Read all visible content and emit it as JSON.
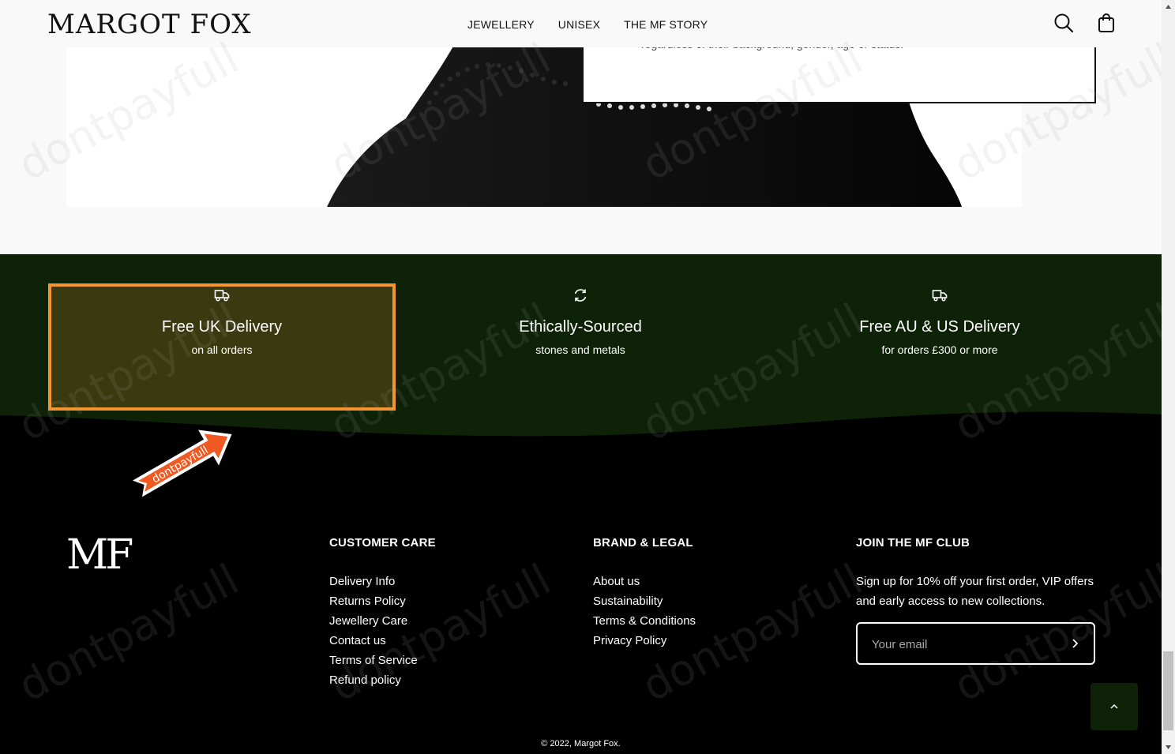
{
  "header": {
    "logo": "MARGOT FOX",
    "nav": [
      "JEWELLERY",
      "UNISEX",
      "THE MF STORY"
    ],
    "search_icon": "search-icon",
    "cart_icon": "shopping-bag-icon"
  },
  "story": {
    "text": "regardless of their background, gender, age or status."
  },
  "usps": [
    {
      "icon": "delivery-truck-icon",
      "title": "Free UK Delivery",
      "subtitle": "on all orders"
    },
    {
      "icon": "refresh-icon",
      "title": "Ethically-Sourced",
      "subtitle": "stones and metals"
    },
    {
      "icon": "delivery-truck-icon",
      "title": "Free AU & US Delivery",
      "subtitle": "for orders £300 or more"
    }
  ],
  "footer": {
    "logo": "MF",
    "customer_care": {
      "heading": "CUSTOMER CARE",
      "links": [
        "Delivery Info",
        "Returns Policy",
        "Jewellery Care",
        "Contact us",
        "Terms of Service",
        "Refund policy"
      ]
    },
    "brand_legal": {
      "heading": "BRAND & LEGAL",
      "links": [
        "About us",
        "Sustainability",
        "Terms & Conditions",
        "Privacy Policy"
      ]
    },
    "club": {
      "heading": "JOIN THE MF CLUB",
      "text": "Sign up for 10% off your first order, VIP offers and early access to new collections.",
      "email_placeholder": "Your email"
    },
    "copyright": "© 2022, Margot Fox."
  },
  "watermark": "dontpayfull",
  "sticker_text": "dontpayfull",
  "colors": {
    "band_green": "#0e2208",
    "highlight_border": "#f7952c",
    "sticker_orange": "#f05a22"
  }
}
